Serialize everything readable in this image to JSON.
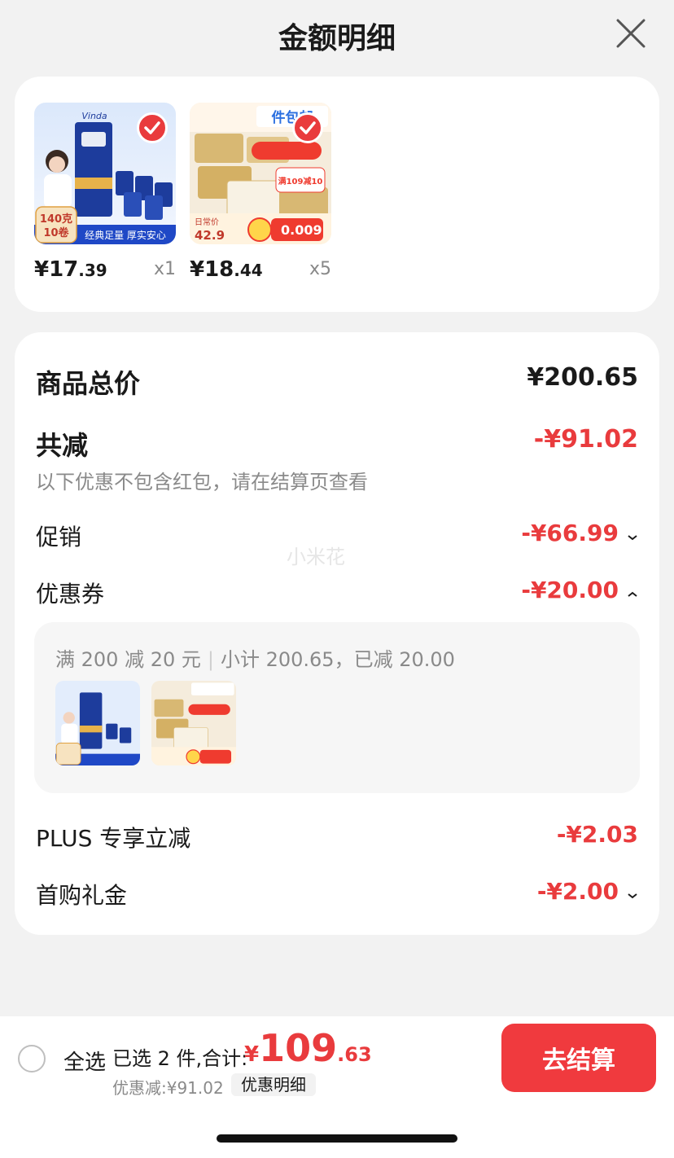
{
  "header": {
    "title": "金额明细"
  },
  "products": [
    {
      "price_int": "¥17",
      "price_dec": ".39",
      "qty": "x1",
      "thumb_badge": "140克\n10卷",
      "thumb_banner": "经典足量  厚实安心",
      "thumb_brand": "Vinda"
    },
    {
      "price_int": "¥18",
      "price_dec": ".44",
      "qty": "x5",
      "thumb_tag": "件包邮",
      "thumb_price": "42.9",
      "thumb_deal": "0.009",
      "thumb_promo": "满109减10"
    }
  ],
  "summary": {
    "total_label": "商品总价",
    "total_value": "¥200.65",
    "discount_label": "共减",
    "discount_value": "-¥91.02",
    "discount_note": "以下优惠不包含红包，请在结算页查看",
    "promo_label": "促销",
    "promo_value": "-¥66.99",
    "coupon_label": "优惠券",
    "coupon_value": "-¥20.00",
    "coupon_desc_a": "满 200 减 20 元",
    "coupon_desc_b": "小计 200.65，已减 20.00",
    "plus_label": "PLUS 专享立减",
    "plus_value": "-¥2.03",
    "first_label": "首购礼金",
    "first_value": "-¥2.00",
    "watermark": "小米花"
  },
  "bottom_bar": {
    "select_all": "全选",
    "selected_text": "已选 2 件,合计:",
    "total_sym": "¥",
    "total_int": "109",
    "total_dec": ".63",
    "discount_line": "优惠减:¥91.02",
    "detail_chip": "优惠明细",
    "checkout": "去结算"
  },
  "colors": {
    "accent_red": "#e93b3d",
    "checkout_red": "#f03a3e",
    "background": "#f2f2f2"
  },
  "icons": {
    "close": "close-icon",
    "check": "check-icon",
    "chevron_down": "chevron-down-icon",
    "chevron_up": "chevron-up-icon"
  }
}
